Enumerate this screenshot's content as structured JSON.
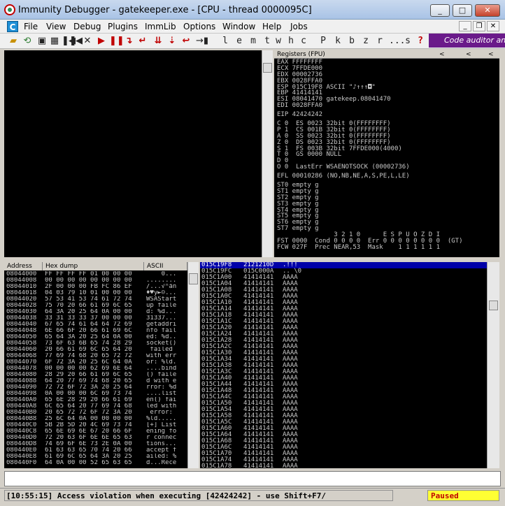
{
  "window": {
    "title": "Immunity Debugger - gatekeeper.exe - [CPU - thread 0000095C]",
    "minimize": "_",
    "maximize": "□",
    "close": "✕"
  },
  "menu": {
    "doc_icon": "C",
    "items": [
      "File",
      "View",
      "Debug",
      "Plugins",
      "ImmLib",
      "Options",
      "Window",
      "Help",
      "Jobs"
    ],
    "mdi_minimize": "_",
    "mdi_restore": "❐",
    "mdi_close": "✕"
  },
  "toolbar": {
    "letters": [
      "l",
      "e",
      "m",
      "t",
      "w",
      "h",
      "c",
      "P",
      "k",
      "b",
      "z",
      "r",
      "...",
      "s",
      "?"
    ],
    "banner": "Code auditor an"
  },
  "registers": {
    "title": "Registers (FPU)",
    "nav": [
      "<",
      "<",
      "<"
    ],
    "lines": [
      "EAX FFFFFFFF",
      "ECX 7FFDE000",
      "EDX 00002736",
      "EBX 0028FFA0",
      "ESP 015C19F8 ASCII \"♪↑↑↑◘\"",
      "EBP 41414141",
      "ESI 08041470 gatekeep.08041470",
      "EDI 0028FFA0",
      "",
      "EIP 42424242",
      "",
      "C 0  ES 0023 32bit 0(FFFFFFFF)",
      "P 1  CS 001B 32bit 0(FFFFFFFF)",
      "A 0  SS 0023 32bit 0(FFFFFFFF)",
      "Z 0  DS 0023 32bit 0(FFFFFFFF)",
      "S 1  FS 003B 32bit 7FFDE000(4000)",
      "T 0  GS 0000 NULL",
      "D 0",
      "O 0  LastErr WSAENOTSOCK (00002736)",
      "",
      "EFL 00010286 (NO,NB,NE,A,S,PE,L,LE)",
      "",
      "ST0 empty g",
      "ST1 empty g",
      "ST2 empty g",
      "ST3 empty g",
      "ST4 empty g",
      "ST5 empty g",
      "ST6 empty g",
      "ST7 empty g",
      "               3 2 1 0      E S P U O Z D I",
      "FST 0000  Cond 0 0 0 0  Err 0 0 0 0 0 0 0 0  (GT)",
      "FCW 027F  Prec NEAR,53  Mask    1 1 1 1 1 1"
    ]
  },
  "dump": {
    "headers": [
      "Address",
      "Hex dump",
      "ASCII"
    ],
    "rows": [
      [
        "08044000",
        "FF FF FF FF 01 00 00 00",
        "    0..."
      ],
      [
        "08044008",
        "00 00 00 00 00 00 00 00",
        "........"
      ],
      [
        "08044010",
        "2F 00 00 00 FB FC 86 EF",
        "/...√ⁿåñ"
      ],
      [
        "08044018",
        "04 03 79 10 01 00 00 00",
        "♦♥y►☺..."
      ],
      [
        "08044020",
        "57 53 41 53 74 61 72 74",
        "WSAStart"
      ],
      [
        "08044028",
        "75 70 20 66 61 69 6C 65",
        "up faile"
      ],
      [
        "08044030",
        "64 3A 20 25 64 0A 00 00",
        "d: %d..."
      ],
      [
        "08044038",
        "33 31 33 33 37 00 00 00",
        "31337..."
      ],
      [
        "08044040",
        "67 65 74 61 64 64 72 69",
        "getaddri"
      ],
      [
        "08044048",
        "6E 66 6F 20 66 61 69 6C",
        "nfo fail"
      ],
      [
        "08044050",
        "65 64 3A 20 25 64 0A 00",
        "ed: %d.."
      ],
      [
        "08044058",
        "73 6F 63 6B 65 74 28 29",
        "socket()"
      ],
      [
        "08044060",
        "20 66 61 69 6C 65 64 20",
        " failed "
      ],
      [
        "08044068",
        "77 69 74 68 20 65 72 72",
        "with err"
      ],
      [
        "08044070",
        "6F 72 3A 20 25 6C 64 0A",
        "or: %ld."
      ],
      [
        "08044078",
        "00 00 00 00 62 69 6E 64",
        "....bind"
      ],
      [
        "08044080",
        "28 29 20 66 61 69 6C 65",
        "() faile"
      ],
      [
        "08044088",
        "64 20 77 69 74 68 20 65",
        "d with e"
      ],
      [
        "08044090",
        "72 72 6F 72 3A 20 25 64",
        "rror: %d"
      ],
      [
        "08044098",
        "0A 00 00 00 6C 69 73 74",
        "....list"
      ],
      [
        "080440A0",
        "65 6E 28 29 20 66 61 69",
        "en() fai"
      ],
      [
        "080440A8",
        "6C 65 64 20 77 69 74 68",
        "led with"
      ],
      [
        "080440B0",
        "20 65 72 72 6F 72 3A 20",
        " error: "
      ],
      [
        "080440B8",
        "25 6C 64 0A 00 00 00 00",
        "%ld....."
      ],
      [
        "080440C0",
        "5B 2B 5D 20 4C 69 73 74",
        "[+] List"
      ],
      [
        "080440C8",
        "65 6E 69 6E 67 20 66 6F",
        "ening fo"
      ],
      [
        "080440D0",
        "72 20 63 6F 6E 6E 65 63",
        "r connec"
      ],
      [
        "080440D8",
        "74 69 6F 6E 73 2E 0A 00",
        "tions..."
      ],
      [
        "080440E0",
        "61 63 63 65 70 74 20 66",
        "accept f"
      ],
      [
        "080440E8",
        "61 69 6C 65 64 3A 20 25",
        "ailed: %"
      ],
      [
        "080440F0",
        "64 0A 00 00 52 65 63 65",
        "d...Rece"
      ]
    ]
  },
  "stack": {
    "rows": [
      [
        "015C19F8",
        "2121210D",
        ".!!!"
      ],
      [
        "015C19FC",
        "015C000A",
        ".. \\0"
      ],
      [
        "015C1A00",
        "41414141",
        "AAAA"
      ],
      [
        "015C1A04",
        "41414141",
        "AAAA"
      ],
      [
        "015C1A08",
        "41414141",
        "AAAA"
      ],
      [
        "015C1A0C",
        "41414141",
        "AAAA"
      ],
      [
        "015C1A10",
        "41414141",
        "AAAA"
      ],
      [
        "015C1A14",
        "41414141",
        "AAAA"
      ],
      [
        "015C1A18",
        "41414141",
        "AAAA"
      ],
      [
        "015C1A1C",
        "41414141",
        "AAAA"
      ],
      [
        "015C1A20",
        "41414141",
        "AAAA"
      ],
      [
        "015C1A24",
        "41414141",
        "AAAA"
      ],
      [
        "015C1A28",
        "41414141",
        "AAAA"
      ],
      [
        "015C1A2C",
        "41414141",
        "AAAA"
      ],
      [
        "015C1A30",
        "41414141",
        "AAAA"
      ],
      [
        "015C1A34",
        "41414141",
        "AAAA"
      ],
      [
        "015C1A38",
        "41414141",
        "AAAA"
      ],
      [
        "015C1A3C",
        "41414141",
        "AAAA"
      ],
      [
        "015C1A40",
        "41414141",
        "AAAA"
      ],
      [
        "015C1A44",
        "41414141",
        "AAAA"
      ],
      [
        "015C1A48",
        "41414141",
        "AAAA"
      ],
      [
        "015C1A4C",
        "41414141",
        "AAAA"
      ],
      [
        "015C1A50",
        "41414141",
        "AAAA"
      ],
      [
        "015C1A54",
        "41414141",
        "AAAA"
      ],
      [
        "015C1A58",
        "41414141",
        "AAAA"
      ],
      [
        "015C1A5C",
        "41414141",
        "AAAA"
      ],
      [
        "015C1A60",
        "41414141",
        "AAAA"
      ],
      [
        "015C1A64",
        "41414141",
        "AAAA"
      ],
      [
        "015C1A68",
        "41414141",
        "AAAA"
      ],
      [
        "015C1A6C",
        "41414141",
        "AAAA"
      ],
      [
        "015C1A70",
        "41414141",
        "AAAA"
      ],
      [
        "015C1A74",
        "41414141",
        "AAAA"
      ],
      [
        "015C1A78",
        "41414141",
        "AAAA"
      ]
    ]
  },
  "status": {
    "message": "[10:55:15] Access violation when executing [42424242] - use Shift+F7/",
    "state": "Paused"
  }
}
